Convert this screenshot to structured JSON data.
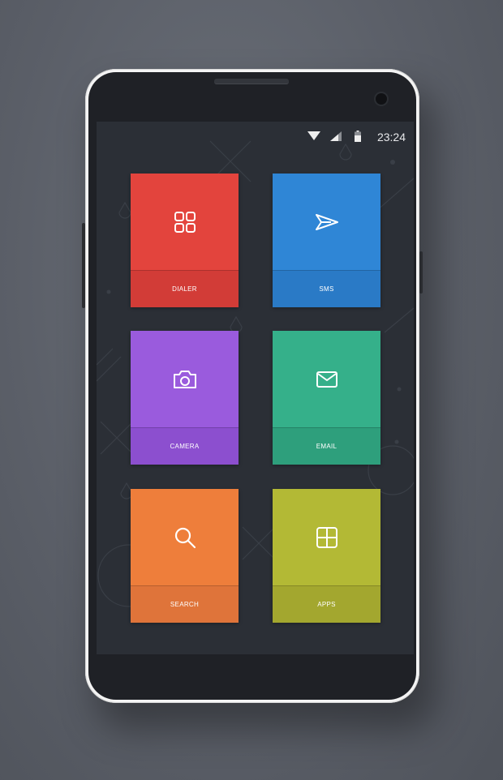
{
  "status_bar": {
    "time": "23:24",
    "icons": [
      "wifi-icon",
      "signal-icon",
      "battery-icon"
    ]
  },
  "tiles": [
    {
      "id": "dialer",
      "label": "DIALER",
      "icon": "grid-four-icon",
      "color_top": "#e3443d",
      "color_bottom": "#d23c37"
    },
    {
      "id": "sms",
      "label": "SMS",
      "icon": "send-icon",
      "color_top": "#2f86d6",
      "color_bottom": "#2a7ac6"
    },
    {
      "id": "camera",
      "label": "CAMERA",
      "icon": "camera-icon",
      "color_top": "#9a5bdd",
      "color_bottom": "#8c4fcf"
    },
    {
      "id": "email",
      "label": "EMAIL",
      "icon": "mail-icon",
      "color_top": "#35b08a",
      "color_bottom": "#2e9f7c"
    },
    {
      "id": "search",
      "label": "SEARCH",
      "icon": "search-icon",
      "color_top": "#ee7e3b",
      "color_bottom": "#df743a"
    },
    {
      "id": "apps",
      "label": "APPS",
      "icon": "apps-icon",
      "color_top": "#b3b935",
      "color_bottom": "#a3a72f"
    }
  ]
}
